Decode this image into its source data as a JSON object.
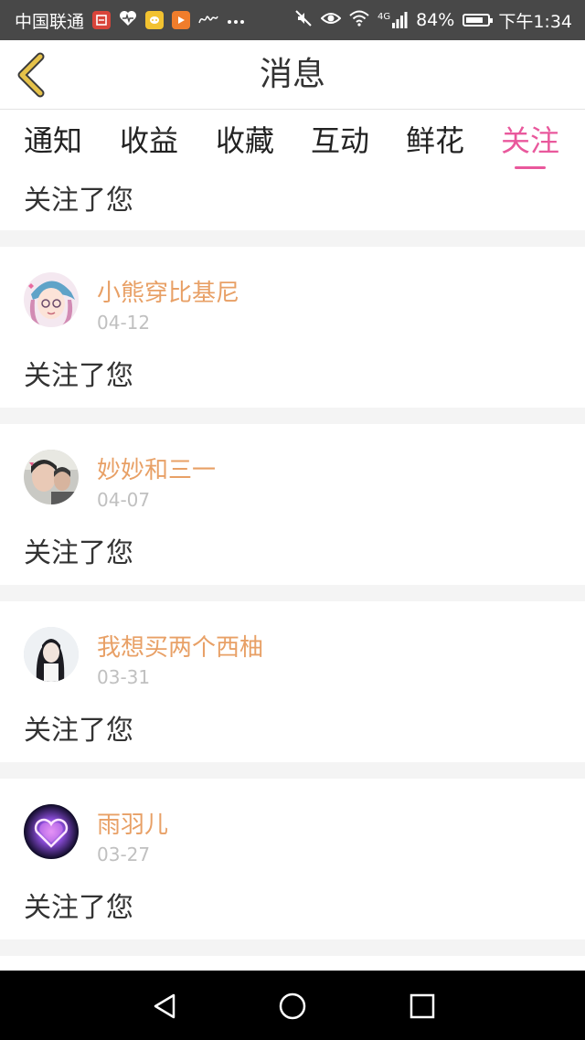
{
  "status_bar": {
    "carrier": "中国联通",
    "network": "4G",
    "battery": "84%",
    "battery_level": 0.84,
    "time": "下午1:34",
    "icons": [
      "app-badge-icon",
      "health-icon",
      "chat-icon",
      "video-icon",
      "signature-icon",
      "more-dots-icon",
      "mute-icon",
      "eye-icon",
      "wifi-icon",
      "signal-icon",
      "battery-icon"
    ]
  },
  "header": {
    "title": "消息",
    "back_icon": "chevron-left-icon"
  },
  "tabs": [
    {
      "label": "通知",
      "active": false
    },
    {
      "label": "收益",
      "active": false
    },
    {
      "label": "收藏",
      "active": false
    },
    {
      "label": "互动",
      "active": false
    },
    {
      "label": "鲜花",
      "active": false
    },
    {
      "label": "关注",
      "active": true
    }
  ],
  "partial_item": {
    "message": "关注了您"
  },
  "items": [
    {
      "name": "小熊穿比基尼",
      "date": "04-12",
      "message": "关注了您"
    },
    {
      "name": "妙妙和三一",
      "date": "04-07",
      "message": "关注了您"
    },
    {
      "name": "我想买两个西柚",
      "date": "03-31",
      "message": "关注了您"
    },
    {
      "name": "雨羽儿",
      "date": "03-27",
      "message": "关注了您"
    }
  ],
  "colors": {
    "accent": "#e9589c",
    "username": "#e8a066",
    "date": "#c0c0c0",
    "back_icon": "#e6c24a"
  },
  "nav_bar": {
    "icons": [
      "back-triangle-icon",
      "home-circle-icon",
      "recents-square-icon"
    ]
  }
}
